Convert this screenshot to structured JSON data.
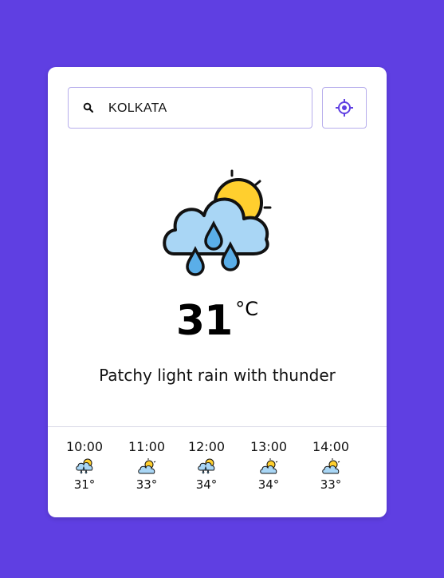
{
  "search": {
    "value": "KOLKATA",
    "icon": "search-icon"
  },
  "location_button": {
    "icon": "location-target-icon",
    "color": "#5f3fe2"
  },
  "current": {
    "temperature": "31",
    "unit": "°C",
    "condition": "Patchy light rain with thunder",
    "icon": "rain-cloud-sun-icon"
  },
  "hourly": [
    {
      "time": "10:00",
      "temp": "31°",
      "icon": "rain-cloud-sun-icon"
    },
    {
      "time": "11:00",
      "temp": "33°",
      "icon": "partly-cloudy-icon"
    },
    {
      "time": "12:00",
      "temp": "34°",
      "icon": "rain-cloud-sun-icon"
    },
    {
      "time": "13:00",
      "temp": "34°",
      "icon": "partly-cloudy-icon"
    },
    {
      "time": "14:00",
      "temp": "33°",
      "icon": "partly-cloudy-icon"
    }
  ],
  "colors": {
    "background": "#5f3fe2",
    "card": "#ffffff",
    "cloud": "#a9d6f5",
    "sun": "#ffcf2e",
    "drop": "#5aaee8"
  }
}
